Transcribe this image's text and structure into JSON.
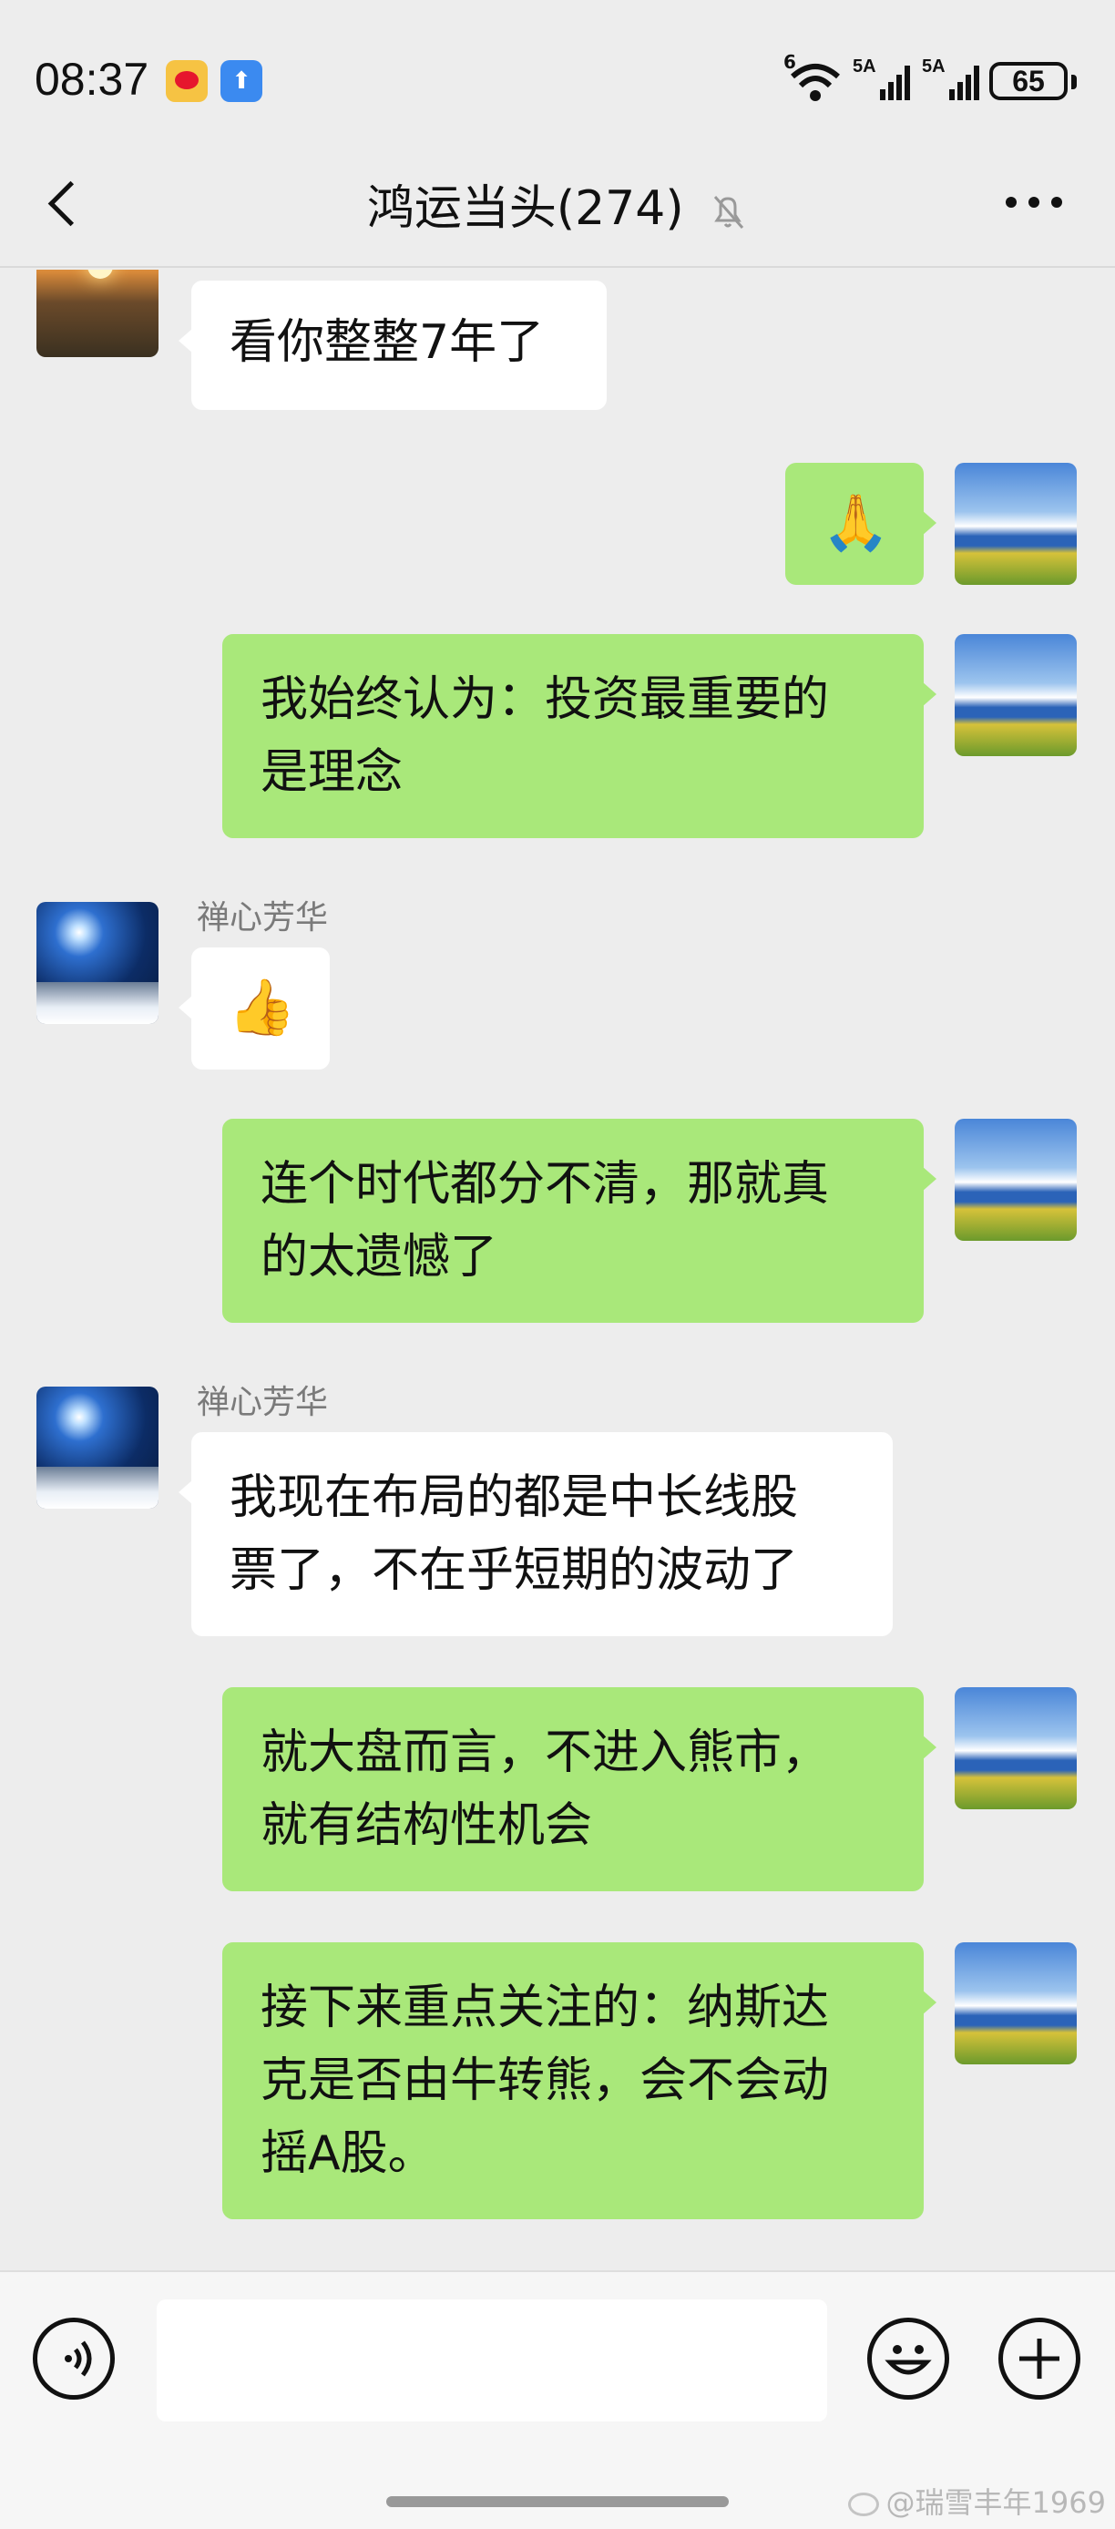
{
  "status_bar": {
    "time": "08:37",
    "battery": "65",
    "cell1_label": "5A",
    "cell2_label": "5A",
    "wifi_label": "6",
    "icons": [
      "weibo-icon",
      "upload-icon",
      "wifi-icon",
      "cell-signal-icon",
      "cell-signal-icon",
      "battery-icon"
    ]
  },
  "header": {
    "title": "鸿运当头(274)",
    "icons": [
      "back-icon",
      "mute-bell-icon",
      "more-icon"
    ]
  },
  "messages": [
    {
      "side": "in",
      "avatar": "sunset-avatar",
      "text": "看你整整7年了"
    },
    {
      "side": "out",
      "avatar": "sea-avatar",
      "text": "🙏"
    },
    {
      "side": "out",
      "avatar": "sea-avatar",
      "text": "我始终认为：投资最重要的\n是理念"
    },
    {
      "side": "in",
      "avatar": "night-avatar",
      "sender": "禅心芳华",
      "text": "👍"
    },
    {
      "side": "out",
      "avatar": "sea-avatar",
      "text": "连个时代都分不清，那就真\n的太遗憾了"
    },
    {
      "side": "in",
      "avatar": "night-avatar",
      "sender": "禅心芳华",
      "text": "我现在布局的都是中长线股\n票了，不在乎短期的波动了"
    },
    {
      "side": "out",
      "avatar": "sea-avatar",
      "text": "就大盘而言，不进入熊市，\n就有结构性机会"
    },
    {
      "side": "out",
      "avatar": "sea-avatar",
      "text": "接下来重点关注的：纳斯达\n克是否由牛转熊，会不会动\n摇A股。"
    }
  ],
  "input_bar": {
    "placeholder": "",
    "icons": [
      "voice-icon",
      "emoji-icon",
      "plus-icon"
    ]
  },
  "watermark": "@瑞雪丰年1969",
  "colors": {
    "background": "#ededed",
    "bubble_out": "#a9e87a",
    "bubble_in": "#ffffff"
  }
}
